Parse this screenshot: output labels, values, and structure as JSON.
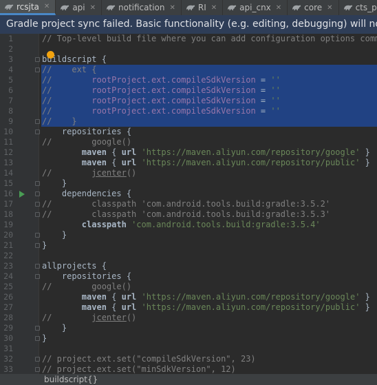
{
  "tabs": [
    {
      "label": "rcsjta",
      "active": true,
      "closable": true
    },
    {
      "label": "api",
      "active": false,
      "closable": true
    },
    {
      "label": "notification",
      "active": false,
      "closable": true
    },
    {
      "label": "RI",
      "active": false,
      "closable": true
    },
    {
      "label": "api_cnx",
      "active": false,
      "closable": true
    },
    {
      "label": "core",
      "active": false,
      "closable": true
    },
    {
      "label": "cts_provi",
      "active": false,
      "closable": false
    }
  ],
  "notification": "Gradle project sync failed. Basic functionality (e.g. editing, debugging) will not work pro",
  "breadcrumb": "buildscript{}",
  "colors": {
    "selection": "#214283",
    "notify_bg": "#2e3d57",
    "editor_bg": "#2b2b2b",
    "accent": "#4a88c7"
  },
  "lines": [
    {
      "n": "1",
      "segs": [
        {
          "t": "// Top-level build file where you can add configuration options common",
          "c": "c-com"
        }
      ]
    },
    {
      "n": "2",
      "segs": []
    },
    {
      "n": "3",
      "segs": [
        {
          "t": "buildscript {",
          "c": "c-plain"
        }
      ]
    },
    {
      "n": "4",
      "sel": true,
      "segs": [
        {
          "t": "//    ext {",
          "c": "c-com"
        }
      ]
    },
    {
      "n": "5",
      "sel": true,
      "segs": [
        {
          "t": "//        ",
          "c": "c-com"
        },
        {
          "t": "rootProject.ext.compileSdkVersion",
          "c": "c-prop"
        },
        {
          "t": " = ",
          "c": "c-plain"
        },
        {
          "t": "''",
          "c": "c-str"
        }
      ]
    },
    {
      "n": "6",
      "sel": true,
      "segs": [
        {
          "t": "//        ",
          "c": "c-com"
        },
        {
          "t": "rootProject.ext.compileSdkVersion",
          "c": "c-prop"
        },
        {
          "t": " = ",
          "c": "c-plain"
        },
        {
          "t": "''",
          "c": "c-str"
        }
      ]
    },
    {
      "n": "7",
      "sel": true,
      "segs": [
        {
          "t": "//        ",
          "c": "c-com"
        },
        {
          "t": "rootProject.ext.compileSdkVersion",
          "c": "c-prop"
        },
        {
          "t": " = ",
          "c": "c-plain"
        },
        {
          "t": "''",
          "c": "c-str"
        }
      ]
    },
    {
      "n": "8",
      "sel": true,
      "segs": [
        {
          "t": "//        ",
          "c": "c-com"
        },
        {
          "t": "rootProject.ext.compileSdkVersion",
          "c": "c-prop"
        },
        {
          "t": " = ",
          "c": "c-plain"
        },
        {
          "t": "''",
          "c": "c-str"
        }
      ]
    },
    {
      "n": "9",
      "sel": true,
      "segs": [
        {
          "t": "//    }",
          "c": "c-com"
        }
      ]
    },
    {
      "n": "10",
      "segs": [
        {
          "t": "    repositories {",
          "c": "c-plain"
        }
      ]
    },
    {
      "n": "11",
      "segs": [
        {
          "t": "//        google()",
          "c": "c-com"
        }
      ]
    },
    {
      "n": "12",
      "segs": [
        {
          "t": "        maven",
          "c": "c-bold"
        },
        {
          "t": " { ",
          "c": "c-plain"
        },
        {
          "t": "url",
          "c": "c-bold"
        },
        {
          "t": " ",
          "c": "c-plain"
        },
        {
          "t": "'https://maven.aliyun.com/repository/google'",
          "c": "c-str"
        },
        {
          "t": " }",
          "c": "c-plain"
        }
      ]
    },
    {
      "n": "13",
      "segs": [
        {
          "t": "        maven",
          "c": "c-bold"
        },
        {
          "t": " { ",
          "c": "c-plain"
        },
        {
          "t": "url",
          "c": "c-bold"
        },
        {
          "t": " ",
          "c": "c-plain"
        },
        {
          "t": "'https://maven.aliyun.com/repository/public'",
          "c": "c-str"
        },
        {
          "t": " }",
          "c": "c-plain"
        }
      ]
    },
    {
      "n": "14",
      "segs": [
        {
          "t": "//        ",
          "c": "c-com"
        },
        {
          "t": "jcenter",
          "c": "c-fn"
        },
        {
          "t": "()",
          "c": "c-com"
        }
      ]
    },
    {
      "n": "15",
      "segs": [
        {
          "t": "    }",
          "c": "c-plain"
        }
      ]
    },
    {
      "n": "16",
      "run": true,
      "segs": [
        {
          "t": "    dependencies {",
          "c": "c-plain"
        }
      ]
    },
    {
      "n": "17",
      "segs": [
        {
          "t": "//        classpath 'com.android.tools.build:gradle:3.5.2'",
          "c": "c-com"
        }
      ]
    },
    {
      "n": "18",
      "segs": [
        {
          "t": "//        classpath 'com.android.tools.build:gradle:3.5.3'",
          "c": "c-com"
        }
      ]
    },
    {
      "n": "19",
      "segs": [
        {
          "t": "        classpath",
          "c": "c-bold"
        },
        {
          "t": " ",
          "c": "c-plain"
        },
        {
          "t": "'com.android.tools.build:gradle:3.5.4'",
          "c": "c-str"
        }
      ]
    },
    {
      "n": "20",
      "segs": [
        {
          "t": "    }",
          "c": "c-plain"
        }
      ]
    },
    {
      "n": "21",
      "segs": [
        {
          "t": "}",
          "c": "c-plain"
        }
      ]
    },
    {
      "n": "22",
      "segs": []
    },
    {
      "n": "23",
      "segs": [
        {
          "t": "allprojects {",
          "c": "c-plain"
        }
      ]
    },
    {
      "n": "24",
      "segs": [
        {
          "t": "    repositories {",
          "c": "c-plain"
        }
      ]
    },
    {
      "n": "25",
      "segs": [
        {
          "t": "//        google()",
          "c": "c-com"
        }
      ]
    },
    {
      "n": "26",
      "segs": [
        {
          "t": "        maven",
          "c": "c-bold"
        },
        {
          "t": " { ",
          "c": "c-plain"
        },
        {
          "t": "url",
          "c": "c-bold"
        },
        {
          "t": " ",
          "c": "c-plain"
        },
        {
          "t": "'https://maven.aliyun.com/repository/google'",
          "c": "c-str"
        },
        {
          "t": " }",
          "c": "c-plain"
        }
      ]
    },
    {
      "n": "27",
      "segs": [
        {
          "t": "        maven",
          "c": "c-bold"
        },
        {
          "t": " { ",
          "c": "c-plain"
        },
        {
          "t": "url",
          "c": "c-bold"
        },
        {
          "t": " ",
          "c": "c-plain"
        },
        {
          "t": "'https://maven.aliyun.com/repository/public'",
          "c": "c-str"
        },
        {
          "t": " }",
          "c": "c-plain"
        }
      ]
    },
    {
      "n": "28",
      "segs": [
        {
          "t": "//        ",
          "c": "c-com"
        },
        {
          "t": "jcenter",
          "c": "c-fn"
        },
        {
          "t": "()",
          "c": "c-com"
        }
      ]
    },
    {
      "n": "29",
      "segs": [
        {
          "t": "    }",
          "c": "c-plain"
        }
      ]
    },
    {
      "n": "30",
      "segs": [
        {
          "t": "}",
          "c": "c-plain"
        }
      ]
    },
    {
      "n": "31",
      "segs": []
    },
    {
      "n": "32",
      "segs": [
        {
          "t": "// project.ext.set(\"compileSdkVersion\", 23)",
          "c": "c-com"
        }
      ]
    },
    {
      "n": "33",
      "segs": [
        {
          "t": "// project.ext.set(\"minSdkVersion\", 12)",
          "c": "c-com"
        }
      ]
    }
  ]
}
